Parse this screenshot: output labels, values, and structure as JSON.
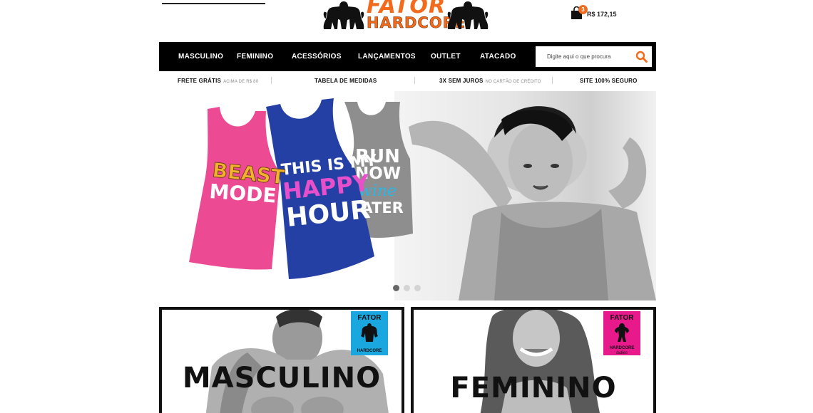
{
  "header": {
    "logo": {
      "line1": "FATOR",
      "line2": "HARDCORE"
    },
    "cart": {
      "count": "3",
      "total": "R$ 172,15"
    }
  },
  "nav": {
    "items": [
      {
        "label": "MASCULINO"
      },
      {
        "label": "FEMININO"
      },
      {
        "label": "ACESSÓRIOS"
      },
      {
        "label": "LANÇAMENTOS"
      },
      {
        "label": "OUTLET"
      },
      {
        "label": "ATACADO"
      }
    ],
    "search": {
      "placeholder": "Digite aqui o que procura",
      "icon": "search-icon"
    }
  },
  "info_bar": {
    "items": [
      {
        "label": "FRETE GRÁTIS",
        "sub": "ACIMA DE R$ 80"
      },
      {
        "label": "TABELA DE MEDIDAS",
        "sub": ""
      },
      {
        "label": "3X SEM JUROS",
        "sub": "NO CARTÃO DE CRÉDITO"
      },
      {
        "label": "SITE 100% SEGURO",
        "sub": ""
      }
    ]
  },
  "hero": {
    "shirts": [
      {
        "line1": "BEAST",
        "line2": "MODE",
        "color": "#ec4a93"
      },
      {
        "line1": "THIS IS MY",
        "line2": "HAPPY",
        "line3": "HOUR",
        "color": "#2440a4"
      },
      {
        "line1": "RUN",
        "line2": "NOW",
        "line3": "wine",
        "line4": "LATER",
        "color": "#8e8e8e"
      }
    ],
    "slider": {
      "count": 3,
      "active": 1
    }
  },
  "categories": [
    {
      "title": "MASCULINO",
      "logo_line1": "FATOR",
      "logo_line2": "HARDCORE",
      "logo_color": "#1aa7df"
    },
    {
      "title": "FEMININO",
      "logo_line1": "FATOR",
      "logo_line2": "HARDCORE",
      "logo_line3": "ladies",
      "logo_color": "#e8198b"
    }
  ],
  "colors": {
    "accent": "#f26a1b",
    "nav_bg": "#000000"
  }
}
